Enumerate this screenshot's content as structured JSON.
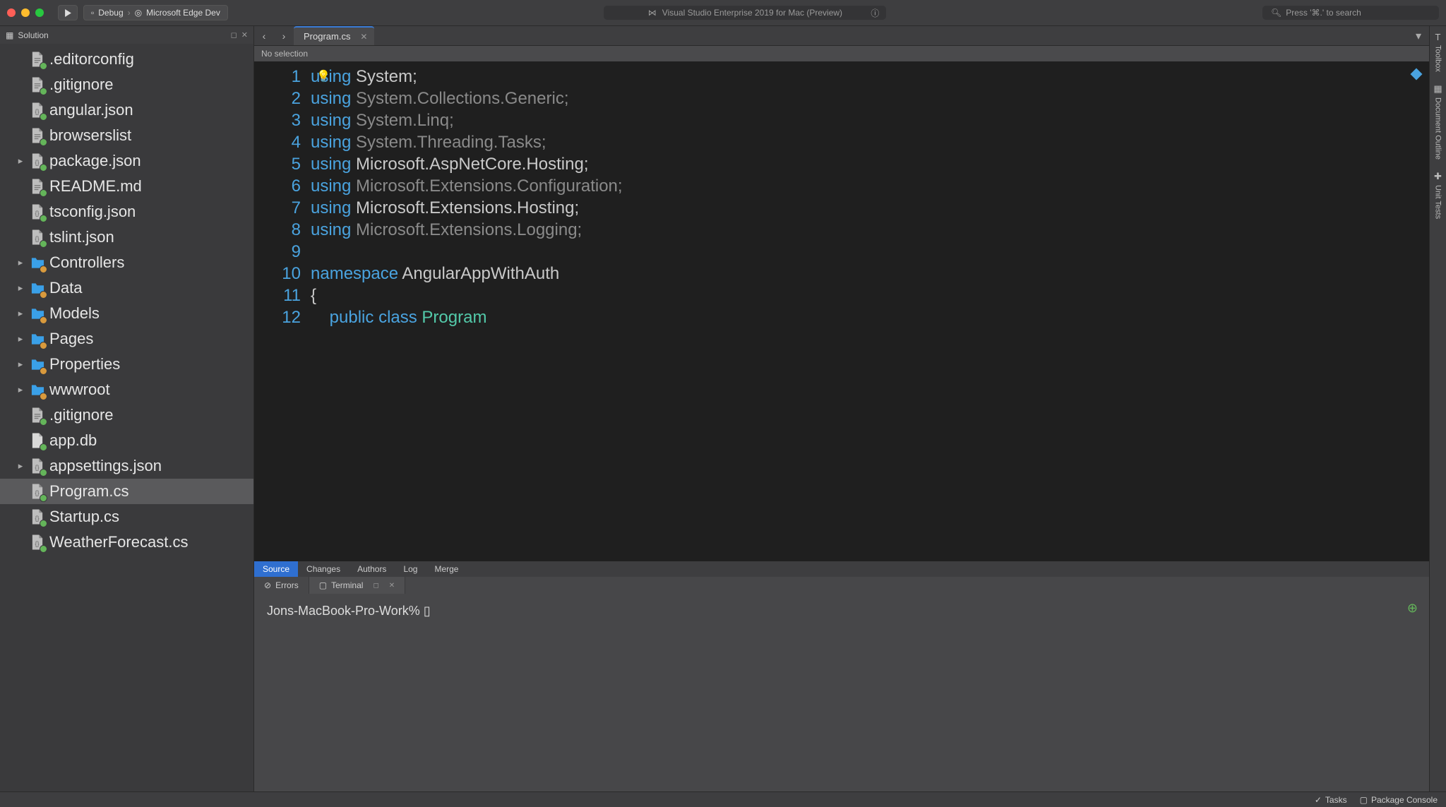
{
  "titlebar": {
    "config_debug": "Debug",
    "config_target": "Microsoft Edge Dev",
    "app_title": "Visual Studio Enterprise 2019 for Mac (Preview)",
    "search_placeholder": "Press '⌘.' to search"
  },
  "sidebar": {
    "title": "Solution",
    "items": [
      {
        "label": ".editorconfig",
        "icon": "page",
        "badge": "add",
        "expandable": false
      },
      {
        "label": ".gitignore",
        "icon": "page",
        "badge": "add",
        "expandable": false
      },
      {
        "label": "angular.json",
        "icon": "code",
        "badge": "add",
        "expandable": false
      },
      {
        "label": "browserslist",
        "icon": "page",
        "badge": "add",
        "expandable": false
      },
      {
        "label": "package.json",
        "icon": "code",
        "badge": "add",
        "expandable": true
      },
      {
        "label": "README.md",
        "icon": "page",
        "badge": "add",
        "expandable": false
      },
      {
        "label": "tsconfig.json",
        "icon": "code",
        "badge": "add",
        "expandable": false
      },
      {
        "label": "tslint.json",
        "icon": "code",
        "badge": "add",
        "expandable": false
      },
      {
        "label": "Controllers",
        "icon": "folder",
        "badge": "mod",
        "expandable": true
      },
      {
        "label": "Data",
        "icon": "folder",
        "badge": "mod",
        "expandable": true
      },
      {
        "label": "Models",
        "icon": "folder",
        "badge": "mod",
        "expandable": true
      },
      {
        "label": "Pages",
        "icon": "folder",
        "badge": "mod",
        "expandable": true
      },
      {
        "label": "Properties",
        "icon": "folder",
        "badge": "mod",
        "expandable": true
      },
      {
        "label": "wwwroot",
        "icon": "folder",
        "badge": "mod",
        "expandable": true
      },
      {
        "label": ".gitignore",
        "icon": "page",
        "badge": "add",
        "expandable": false
      },
      {
        "label": "app.db",
        "icon": "blank",
        "badge": "add",
        "expandable": false
      },
      {
        "label": "appsettings.json",
        "icon": "code",
        "badge": "add",
        "expandable": true
      },
      {
        "label": "Program.cs",
        "icon": "code",
        "badge": "add",
        "expandable": false,
        "selected": true
      },
      {
        "label": "Startup.cs",
        "icon": "code",
        "badge": "add",
        "expandable": false
      },
      {
        "label": "WeatherForecast.cs",
        "icon": "code",
        "badge": "add",
        "expandable": false
      }
    ]
  },
  "editor": {
    "tab_label": "Program.cs",
    "breadcrumb": "No selection",
    "lines": [
      {
        "n": 1,
        "tokens": [
          [
            "kw",
            "using"
          ],
          [
            "sp",
            " "
          ],
          [
            "ns",
            "System"
          ],
          [
            "ns",
            ";"
          ]
        ]
      },
      {
        "n": 2,
        "tokens": [
          [
            "kw",
            "using"
          ],
          [
            "sp",
            " "
          ],
          [
            "dim",
            "System.Collections.Generic;"
          ]
        ]
      },
      {
        "n": 3,
        "tokens": [
          [
            "kw",
            "using"
          ],
          [
            "sp",
            " "
          ],
          [
            "dim",
            "System.Linq;"
          ]
        ]
      },
      {
        "n": 4,
        "tokens": [
          [
            "kw",
            "using"
          ],
          [
            "sp",
            " "
          ],
          [
            "dim",
            "System.Threading.Tasks;"
          ]
        ]
      },
      {
        "n": 5,
        "tokens": [
          [
            "kw",
            "using"
          ],
          [
            "sp",
            " "
          ],
          [
            "ns",
            "Microsoft.AspNetCore.Hosting;"
          ]
        ]
      },
      {
        "n": 6,
        "tokens": [
          [
            "kw",
            "using"
          ],
          [
            "sp",
            " "
          ],
          [
            "dim",
            "Microsoft.Extensions.Configuration;"
          ]
        ]
      },
      {
        "n": 7,
        "tokens": [
          [
            "kw",
            "using"
          ],
          [
            "sp",
            " "
          ],
          [
            "ns",
            "Microsoft.Extensions.Hosting;"
          ]
        ]
      },
      {
        "n": 8,
        "tokens": [
          [
            "kw",
            "using"
          ],
          [
            "sp",
            " "
          ],
          [
            "dim",
            "Microsoft.Extensions.Logging;"
          ]
        ]
      },
      {
        "n": 9,
        "tokens": []
      },
      {
        "n": 10,
        "tokens": [
          [
            "kw",
            "namespace"
          ],
          [
            "sp",
            " "
          ],
          [
            "ns",
            "AngularAppWithAuth"
          ]
        ]
      },
      {
        "n": 11,
        "tokens": [
          [
            "ns",
            "{"
          ]
        ]
      },
      {
        "n": 12,
        "tokens": [
          [
            "sp",
            "    "
          ],
          [
            "kw",
            "public"
          ],
          [
            "sp",
            " "
          ],
          [
            "kw",
            "class"
          ],
          [
            "sp",
            " "
          ],
          [
            "cls",
            "Program"
          ]
        ]
      }
    ]
  },
  "sc_tabs": [
    "Source",
    "Changes",
    "Authors",
    "Log",
    "Merge"
  ],
  "bottom_tabs": {
    "errors": "Errors",
    "terminal": "Terminal"
  },
  "terminal_prompt": "Jons-MacBook-Pro-Work% ",
  "rightrail": [
    "Toolbox",
    "Document Outline",
    "Unit Tests"
  ],
  "statusbar": {
    "tasks": "Tasks",
    "package": "Package Console"
  }
}
